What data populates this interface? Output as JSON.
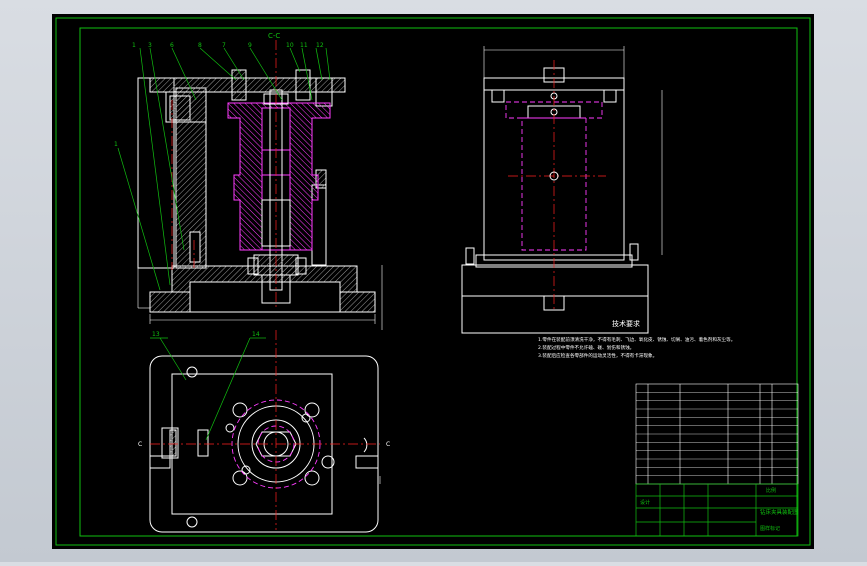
{
  "drawing": {
    "section_label": "C-C",
    "section_marker_left": "C",
    "section_marker_right": "C",
    "balloons_top": [
      "1",
      "3",
      "6",
      "8",
      "7",
      "9",
      "10",
      "11",
      "12"
    ],
    "balloon_left": "1",
    "balloon_plan_a": "13",
    "balloon_plan_b": "14",
    "dim_marks": [
      "Φ",
      "Φ",
      "Φ"
    ]
  },
  "tech_requirements": {
    "heading": "技术要求",
    "lines": [
      "1.零件在装配前须清洗干净，不得有毛刺、飞边、氧化皮、锈蚀、切屑、油污、着色剂和灰尘等。",
      "2.装配过程中零件不允许磕、碰、划伤和锈蚀。",
      "3.装配后应检查各零部件的运动灵活性，不得有卡滞现象。"
    ]
  },
  "title_block": {
    "name": "钻床夹具装配图",
    "material": "比例",
    "company": "设计",
    "sheet": "图样标记"
  },
  "colors": {
    "background": "#000000",
    "frame": "#10c010",
    "outline": "#ffffff",
    "section": "#ff3cff",
    "centerline": "#ff2020",
    "hatch": "#b0b0b0"
  }
}
